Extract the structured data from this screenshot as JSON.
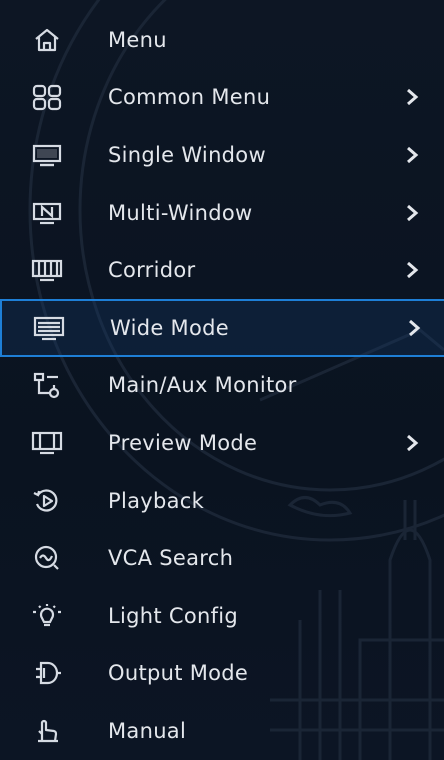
{
  "menu": {
    "items": [
      {
        "label": "Menu",
        "icon": "home-icon",
        "has_submenu": false,
        "selected": false
      },
      {
        "label": "Common Menu",
        "icon": "grid-icon",
        "has_submenu": true,
        "selected": false
      },
      {
        "label": "Single Window",
        "icon": "monitor-icon",
        "has_submenu": true,
        "selected": false
      },
      {
        "label": "Multi-Window",
        "icon": "multi-window-icon",
        "has_submenu": true,
        "selected": false
      },
      {
        "label": "Corridor",
        "icon": "corridor-icon",
        "has_submenu": true,
        "selected": false
      },
      {
        "label": "Wide Mode",
        "icon": "wide-mode-icon",
        "has_submenu": true,
        "selected": true
      },
      {
        "label": "Main/Aux Monitor",
        "icon": "main-aux-monitor-icon",
        "has_submenu": false,
        "selected": false
      },
      {
        "label": "Preview Mode",
        "icon": "preview-mode-icon",
        "has_submenu": true,
        "selected": false
      },
      {
        "label": "Playback",
        "icon": "playback-icon",
        "has_submenu": false,
        "selected": false
      },
      {
        "label": "VCA Search",
        "icon": "vca-search-icon",
        "has_submenu": false,
        "selected": false
      },
      {
        "label": "Light Config",
        "icon": "light-bulb-icon",
        "has_submenu": false,
        "selected": false
      },
      {
        "label": "Output Mode",
        "icon": "output-mode-icon",
        "has_submenu": false,
        "selected": false
      },
      {
        "label": "Manual",
        "icon": "manual-icon",
        "has_submenu": false,
        "selected": false
      }
    ]
  },
  "colors": {
    "background": "#0b1422",
    "text": "#e4e7ec",
    "selection_border": "#1e7fd6",
    "icon": "#d6dbe3"
  }
}
